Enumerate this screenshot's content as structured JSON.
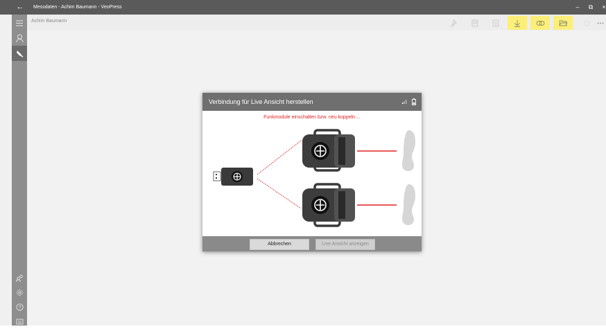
{
  "window": {
    "title": "Messdaten - Achim Baumann - VeoPress",
    "back_icon": "back-arrow-icon",
    "controls": [
      "minimize-icon",
      "restore-icon",
      "close-icon"
    ]
  },
  "header": {
    "breadcrumb": "Achim Baumann"
  },
  "toolbar": {
    "buttons": [
      {
        "icon": "pin-icon",
        "highlighted": false
      },
      {
        "icon": "document-icon",
        "highlighted": false
      },
      {
        "icon": "document-lines-icon",
        "highlighted": false
      },
      {
        "icon": "download-icon",
        "highlighted": true
      },
      {
        "icon": "link-icon",
        "highlighted": true
      },
      {
        "icon": "folder-open-icon",
        "highlighted": true
      },
      {
        "icon": "settings-icon",
        "highlighted": false
      },
      {
        "icon": "more-icon",
        "highlighted": false
      }
    ],
    "highlight_color": "#fbef7a"
  },
  "sidebar": {
    "items": [
      {
        "icon": "hamburger-icon"
      },
      {
        "icon": "person-icon"
      },
      {
        "icon": "foot-icon",
        "active": true
      }
    ],
    "bottom_items": [
      {
        "icon": "users-icon"
      },
      {
        "icon": "gear-icon"
      },
      {
        "icon": "help-icon"
      },
      {
        "icon": "info-icon"
      }
    ]
  },
  "dialog": {
    "title": "Verbindung für Live Ansicht herstellen",
    "message": "Funkmodule einschalten bzw. neu koppeln ...",
    "message_color": "#e02020",
    "cancel_label": "Abbrechen",
    "live_label": "Live Ansicht anzeigen",
    "header_icons": [
      "signal-icon",
      "battery-icon"
    ]
  }
}
